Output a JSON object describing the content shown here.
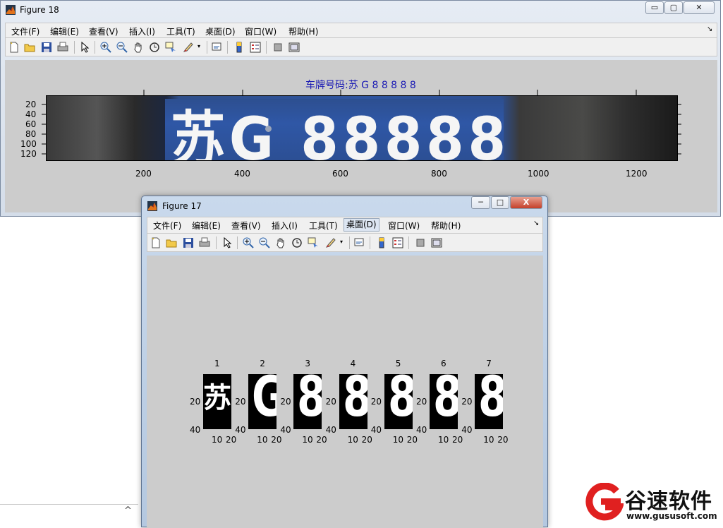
{
  "fig18": {
    "title": "Figure 18",
    "controls": {
      "minimize": "▭",
      "maximize": "▢",
      "close": "✕"
    },
    "menu": [
      "文件(F)",
      "编辑(E)",
      "查看(V)",
      "插入(I)",
      "工具(T)",
      "桌面(D)",
      "窗口(W)",
      "帮助(H)"
    ],
    "menu_arrow": "↘",
    "plot": {
      "title": "车牌号码:苏 G 8 8 8 8 8",
      "plate_text": "苏G 88888",
      "x_ticks": [
        "200",
        "400",
        "600",
        "800",
        "1000",
        "1200"
      ],
      "y_ticks": [
        "20",
        "40",
        "60",
        "80",
        "100",
        "120"
      ]
    }
  },
  "fig17": {
    "title": "Figure 17",
    "controls": {
      "minimize": "─",
      "maximize": "□",
      "close": "X"
    },
    "menu": [
      "文件(F)",
      "编辑(E)",
      "查看(V)",
      "插入(I)",
      "工具(T)",
      "桌面(D)",
      "窗口(W)",
      "帮助(H)"
    ],
    "menu_arrow": "↘",
    "subplots": [
      {
        "index": "1",
        "char": "苏"
      },
      {
        "index": "2",
        "char": "G"
      },
      {
        "index": "3",
        "char": "8"
      },
      {
        "index": "4",
        "char": "8"
      },
      {
        "index": "5",
        "char": "8"
      },
      {
        "index": "6",
        "char": "8"
      },
      {
        "index": "7",
        "char": "8"
      }
    ],
    "y_ticks": [
      "20",
      "40"
    ],
    "x_ticks": [
      "10",
      "20"
    ]
  },
  "watermark": {
    "brand": "谷速软件",
    "url": "www.gususoft.com"
  },
  "taskbar": {
    "chevron": "^"
  }
}
